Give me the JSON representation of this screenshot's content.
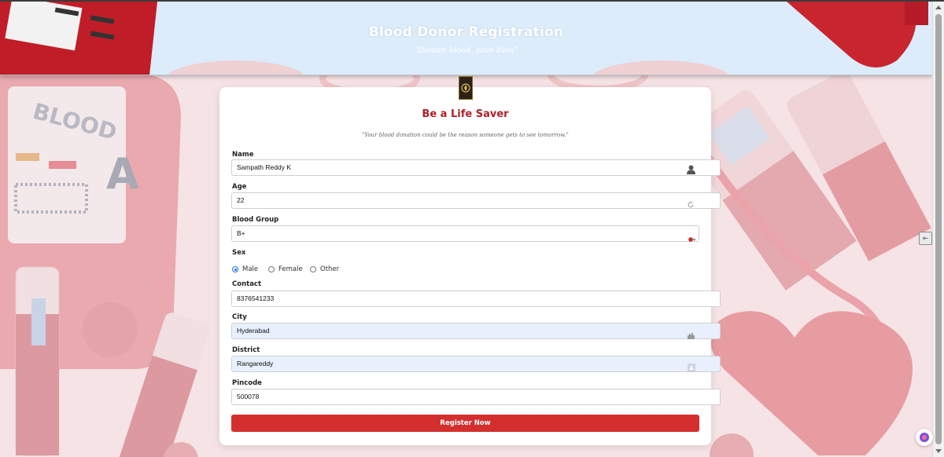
{
  "header": {
    "title": "Blood Donor Registration",
    "subtitle": "\"Donate blood, save lives\""
  },
  "card": {
    "title": "Be a Life Saver",
    "quote": "\"Your blood donation could be the reason someone gets to see tomorrow.\""
  },
  "form": {
    "name": {
      "label": "Name",
      "value": "Sampath Reddy K",
      "icon": "user-icon"
    },
    "age": {
      "label": "Age",
      "value": "22",
      "icon": "refresh-icon"
    },
    "blood_group": {
      "label": "Blood Group",
      "value": "B+",
      "icon": "blood-drop-icon"
    },
    "sex": {
      "label": "Sex",
      "options": [
        "Male",
        "Female",
        "Other"
      ],
      "selected": "Male"
    },
    "contact": {
      "label": "Contact",
      "value": "8376541233"
    },
    "city": {
      "label": "City",
      "value": "Hyderabad",
      "icon": "city-icon"
    },
    "district": {
      "label": "District",
      "value": "Rangareddy",
      "icon": "map-icon"
    },
    "pincode": {
      "label": "Pincode",
      "value": "500078"
    },
    "submit_label": "Register Now"
  },
  "background_art": {
    "bag_label_top": "BLOOD",
    "bag_label_letter": "A"
  },
  "colors": {
    "accent": "#d32f2f",
    "title_red": "#b0202a",
    "header_bg": "#dcecfb",
    "autofill_bg": "#e8f0fe"
  }
}
